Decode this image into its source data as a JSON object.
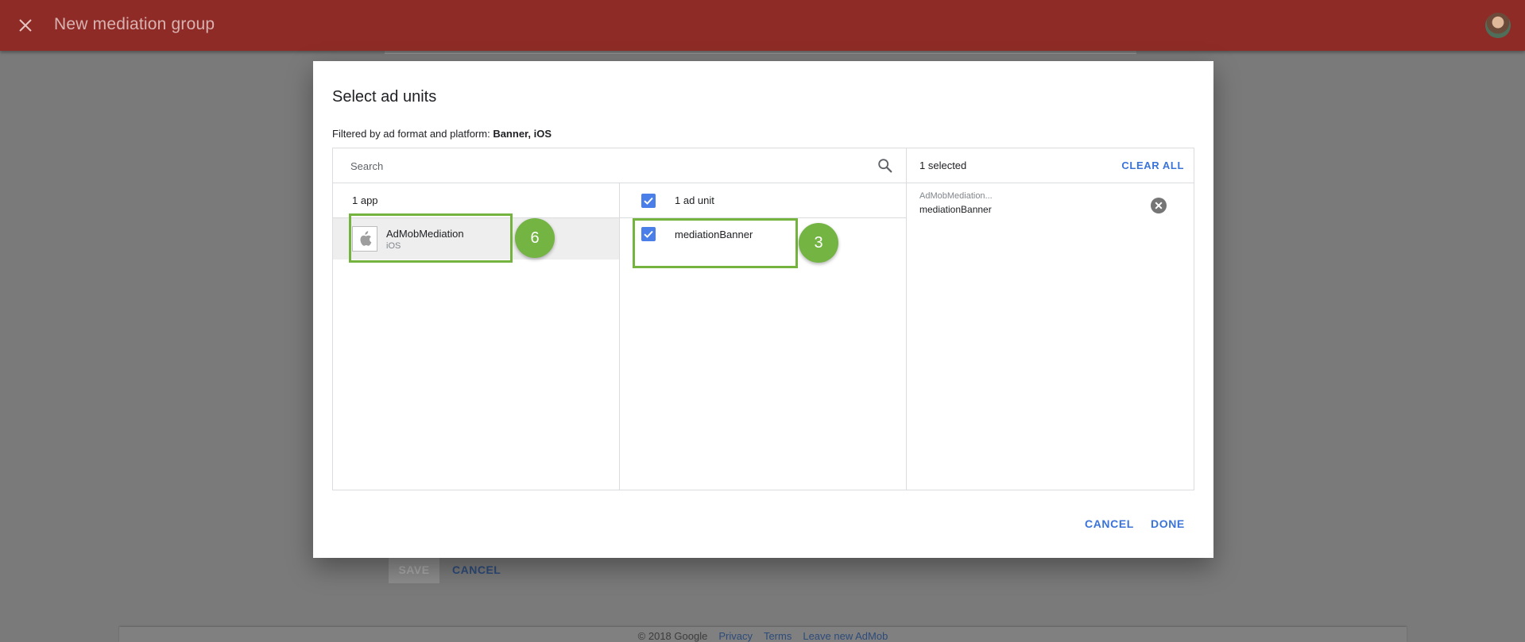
{
  "appbar": {
    "title": "New mediation group",
    "close_icon": "close-icon",
    "avatar": "user-avatar"
  },
  "background": {
    "save_label": "SAVE",
    "cancel_label": "CANCEL",
    "footer": {
      "copyright": "© 2018 Google",
      "links": [
        "Privacy",
        "Terms",
        "Leave new AdMob"
      ]
    }
  },
  "dialog": {
    "title": "Select ad units",
    "filter_prefix": "Filtered by ad format and platform: ",
    "filter_value": "Banner, iOS",
    "search": {
      "placeholder": "Search",
      "value": ""
    },
    "apps": {
      "count_label": "1 app",
      "items": [
        {
          "name": "AdMobMediation",
          "platform": "iOS",
          "icon": "apple-icon"
        }
      ]
    },
    "ad_units": {
      "count_label": "1 ad unit",
      "all_checked": true,
      "items": [
        {
          "name": "mediationBanner",
          "checked": true
        }
      ]
    },
    "selected": {
      "count_label": "1 selected",
      "clear_all_label": "CLEAR ALL",
      "items": [
        {
          "app": "AdMobMediation...",
          "unit": "mediationBanner"
        }
      ]
    },
    "cancel_label": "CANCEL",
    "done_label": "DONE"
  },
  "annotations": {
    "badge_app": "6",
    "badge_unit": "3"
  },
  "colors": {
    "appbar": "#8e2b27",
    "accent": "#3a74d8",
    "checkbox": "#4a7ee8",
    "annotation": "#73b442"
  }
}
